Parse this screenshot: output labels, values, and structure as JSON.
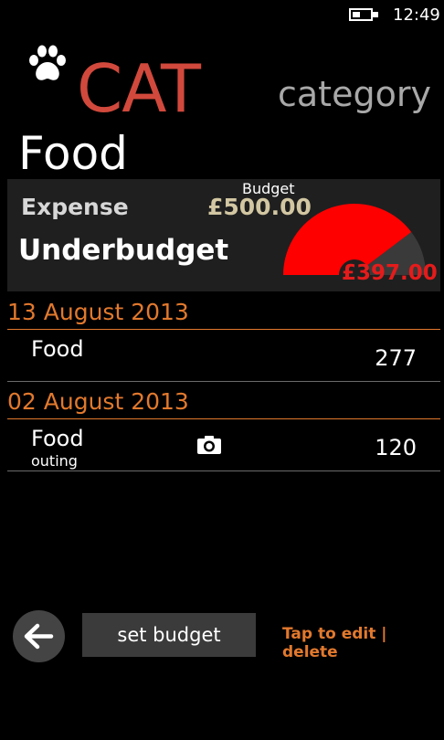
{
  "status_bar": {
    "time": "12:49",
    "battery_icon": "battery-charging-icon"
  },
  "header": {
    "app_icon": "paw-icon",
    "app_title": "CAT",
    "pivot_title": "category",
    "category_name": "Food"
  },
  "summary": {
    "expense_label": "Expense",
    "status": "Underbudget",
    "budget_label": "Budget",
    "budget_amount": "£500.00",
    "spent_amount": "£397.00",
    "gauge_fraction": 0.794,
    "colors": {
      "spent": "#ff0000",
      "remaining": "#3a3a3a",
      "accent": "#e2792d",
      "title": "#d1493c"
    }
  },
  "transactions": [
    {
      "date": "13 August 2013",
      "items": [
        {
          "name": "Food",
          "note": "",
          "amount": "277",
          "has_photo": false
        }
      ]
    },
    {
      "date": "02 August 2013",
      "items": [
        {
          "name": "Food",
          "note": "outing",
          "amount": "120",
          "has_photo": true,
          "photo_icon": "camera-icon"
        }
      ]
    }
  ],
  "app_bar": {
    "back_icon": "back-arrow-icon",
    "set_budget_label": "set budget",
    "edit_hint": "Tap to edit | delete"
  }
}
